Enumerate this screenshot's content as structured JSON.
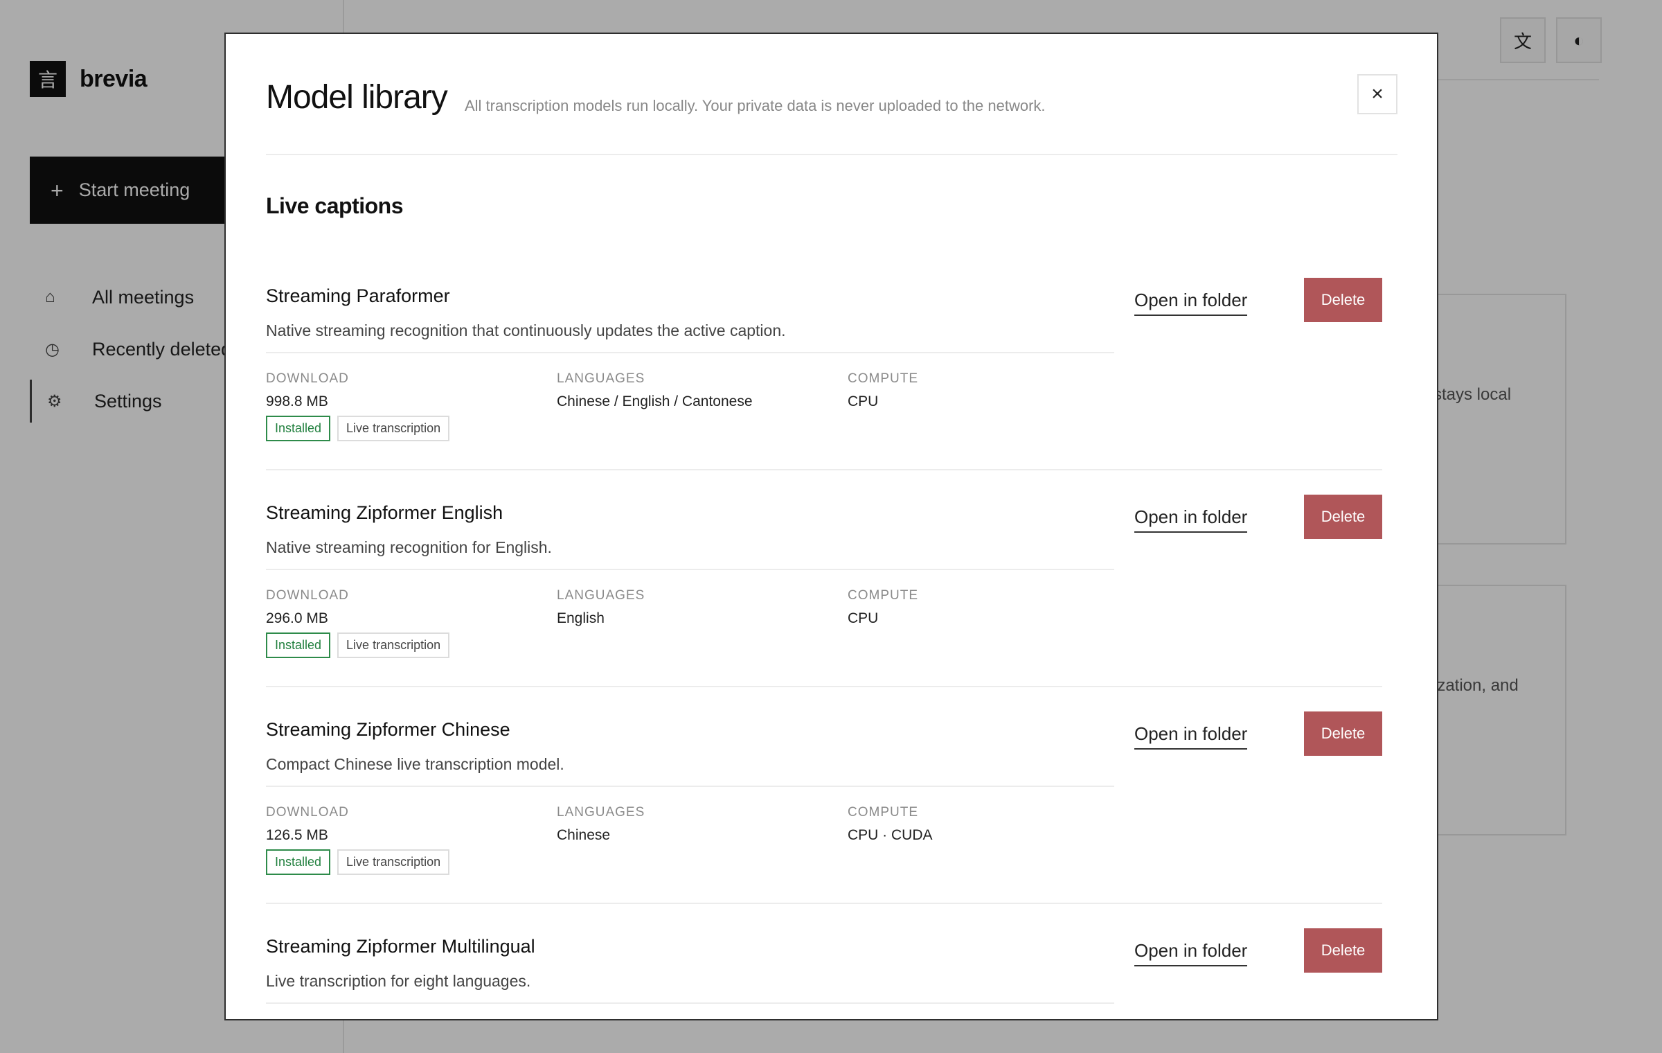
{
  "sidebar": {
    "brand": {
      "logo_glyph": "言",
      "name": "brevia"
    },
    "start_button": {
      "icon": "plus-icon",
      "label": "Start meeting"
    },
    "nav": [
      {
        "icon": "home-icon",
        "glyph": "⌂",
        "label": "All meetings",
        "active": false
      },
      {
        "icon": "clock-icon",
        "glyph": "◷",
        "label": "Recently deleted",
        "active": false
      },
      {
        "icon": "gear-icon",
        "glyph": "⚙",
        "label": "Settings",
        "active": true
      }
    ]
  },
  "toolbar": {
    "language_glyph": "文",
    "theme_glyph": "◐"
  },
  "background": {
    "card1_text": "stays local",
    "card2_text": "ization, and"
  },
  "modal": {
    "title": "Model library",
    "subtitle": "All transcription models run locally. Your private data is never uploaded to the network.",
    "close_glyph": "×",
    "section_title": "Live captions",
    "labels": {
      "download": "DOWNLOAD",
      "languages": "LANGUAGES",
      "compute": "COMPUTE",
      "open_folder": "Open in folder",
      "delete": "Delete"
    },
    "models": [
      {
        "name": "Streaming Paraformer",
        "description": "Native streaming recognition that continuously updates the active caption.",
        "download": "998.8 MB",
        "languages": "Chinese / English / Cantonese",
        "compute": "CPU",
        "tags": [
          "Installed",
          "Live transcription"
        ]
      },
      {
        "name": "Streaming Zipformer English",
        "description": "Native streaming recognition for English.",
        "download": "296.0 MB",
        "languages": "English",
        "compute": "CPU",
        "tags": [
          "Installed",
          "Live transcription"
        ]
      },
      {
        "name": "Streaming Zipformer Chinese",
        "description": "Compact Chinese live transcription model.",
        "download": "126.5 MB",
        "languages": "Chinese",
        "compute": "CPU · CUDA",
        "tags": [
          "Installed",
          "Live transcription"
        ]
      },
      {
        "name": "Streaming Zipformer Multilingual",
        "description": "Live transcription for eight languages."
      }
    ]
  }
}
